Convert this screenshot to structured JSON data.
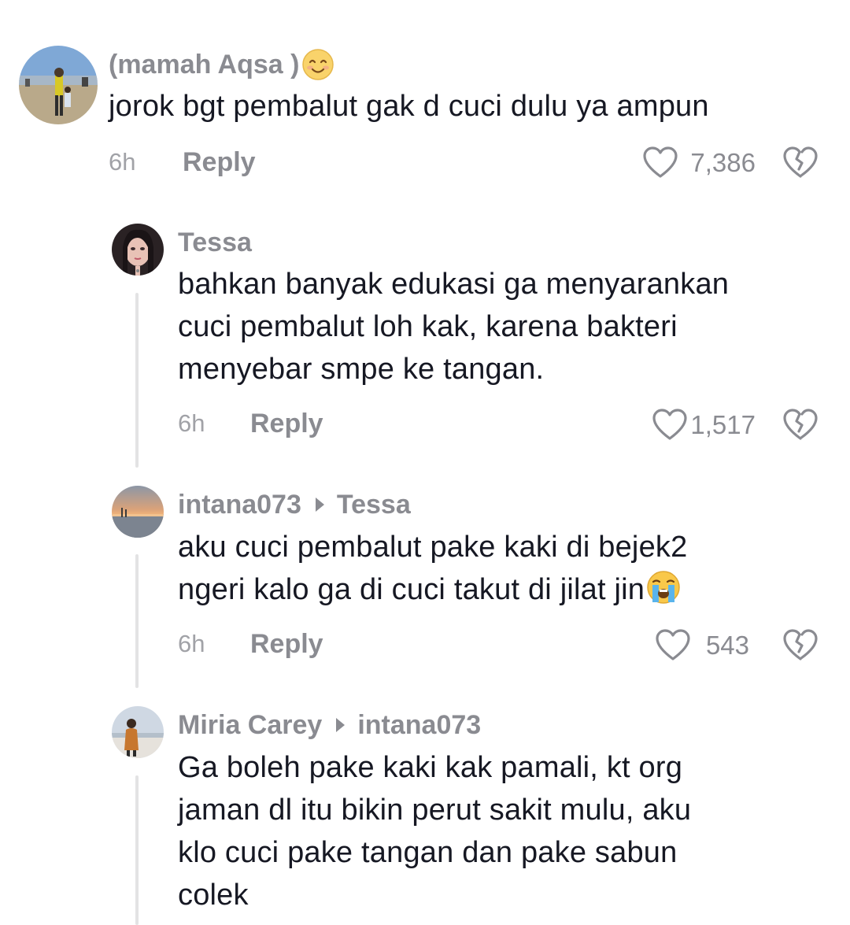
{
  "comments": [
    {
      "username": "(mamah Aqsa )",
      "text_lines": [
        "jorok bgt pembalut gak d cuci dulu ya ampun"
      ],
      "time": "6h",
      "reply": "Reply",
      "likes": "7,386",
      "avatar_icon": "beach-photo-avatar",
      "name_emoji": "smiling-face-emoji"
    },
    {
      "username": "Tessa",
      "text_lines": [
        "bahkan banyak edukasi ga menyarankan",
        "cuci pembalut loh kak, karena bakteri",
        "menyebar smpe ke tangan."
      ],
      "time": "6h",
      "reply": "Reply",
      "likes": "1,517",
      "avatar_icon": "selfie-avatar"
    },
    {
      "username": "intana073",
      "reply_to": "Tessa",
      "text_lines": [
        "aku cuci pembalut pake kaki di bejek2",
        "ngeri kalo ga di cuci takut di jilat jin"
      ],
      "text_emoji": "crying-face-emoji",
      "time": "6h",
      "reply": "Reply",
      "likes": "543",
      "avatar_icon": "sunset-avatar"
    },
    {
      "username": "Miria Carey",
      "reply_to": "intana073",
      "text_lines": [
        "Ga boleh pake kaki kak pamali, kt org",
        "jaman dl itu bikin perut sakit mulu, aku",
        "klo cuci pake tangan dan pake sabun",
        "colek"
      ],
      "avatar_icon": "person-standing-avatar"
    }
  ],
  "colors": {
    "username": "#8a8b91",
    "text": "#161823",
    "meta": "#a1a2a7",
    "thread_line": "#e3e3e4"
  }
}
